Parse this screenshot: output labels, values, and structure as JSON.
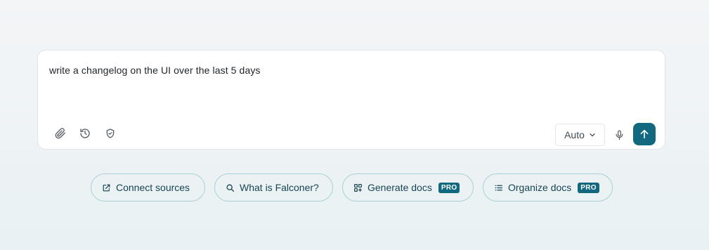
{
  "composer": {
    "prompt_text": "write a changelog on the UI over the last 5 days",
    "tools": [
      {
        "icon": "paperclip-icon"
      },
      {
        "icon": "history-icon"
      },
      {
        "icon": "shield-icon"
      }
    ],
    "mode_select": {
      "value": "Auto"
    },
    "mic_icon": "microphone-icon",
    "send_icon": "arrow-up-icon"
  },
  "suggestions": [
    {
      "label": "Connect sources",
      "icon": "external-link-icon",
      "badge": ""
    },
    {
      "label": "What is Falconer?",
      "icon": "search-icon",
      "badge": ""
    },
    {
      "label": "Generate docs",
      "icon": "grid-plus-icon",
      "badge": "PRO"
    },
    {
      "label": "Organize docs",
      "icon": "list-icon",
      "badge": "PRO"
    }
  ],
  "colors": {
    "accent": "#12687f",
    "chip_border": "#a9cfd6",
    "chip_text": "#174553"
  }
}
